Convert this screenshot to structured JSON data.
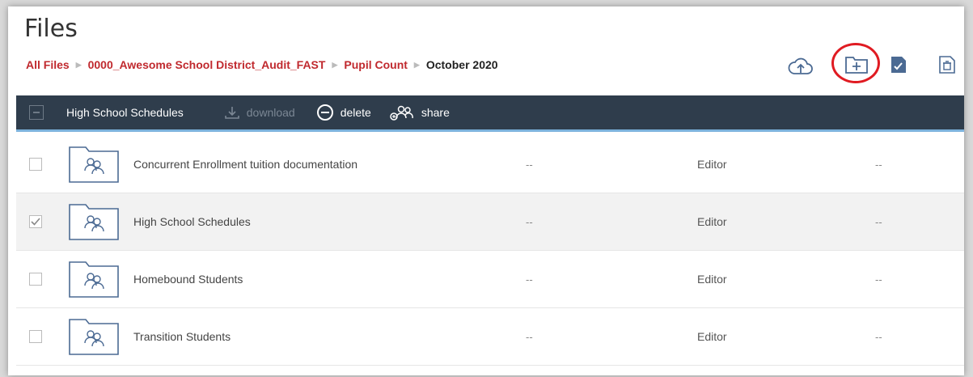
{
  "page": {
    "title": "Files"
  },
  "breadcrumb": {
    "items": [
      "All Files",
      "0000_Awesome School District_Audit_FAST",
      "Pupil Count"
    ],
    "current": "October 2020"
  },
  "toolbar": {
    "selected_name": "High School Schedules",
    "download_label": "download",
    "delete_label": "delete",
    "share_label": "share"
  },
  "rows": [
    {
      "name": "Concurrent Enrollment tuition documentation",
      "col2": "--",
      "role": "Editor",
      "col4": "--",
      "checked": false
    },
    {
      "name": "High School Schedules",
      "col2": "--",
      "role": "Editor",
      "col4": "--",
      "checked": true
    },
    {
      "name": "Homebound Students",
      "col2": "--",
      "role": "Editor",
      "col4": "--",
      "checked": false
    },
    {
      "name": "Transition Students",
      "col2": "--",
      "role": "Editor",
      "col4": "--",
      "checked": false
    }
  ],
  "icons": [
    "cloud-upload-icon",
    "new-folder-icon",
    "task-icon",
    "trash-icon",
    "shared-folder-icon",
    "download-icon",
    "delete-icon",
    "share-icon"
  ],
  "colors": {
    "link": "#c0292e",
    "toolbar": "#2f3d4c",
    "toolbar_border": "#7db3dd",
    "icon_blue": "#4b6a93",
    "highlight_ring": "#e01b22"
  }
}
